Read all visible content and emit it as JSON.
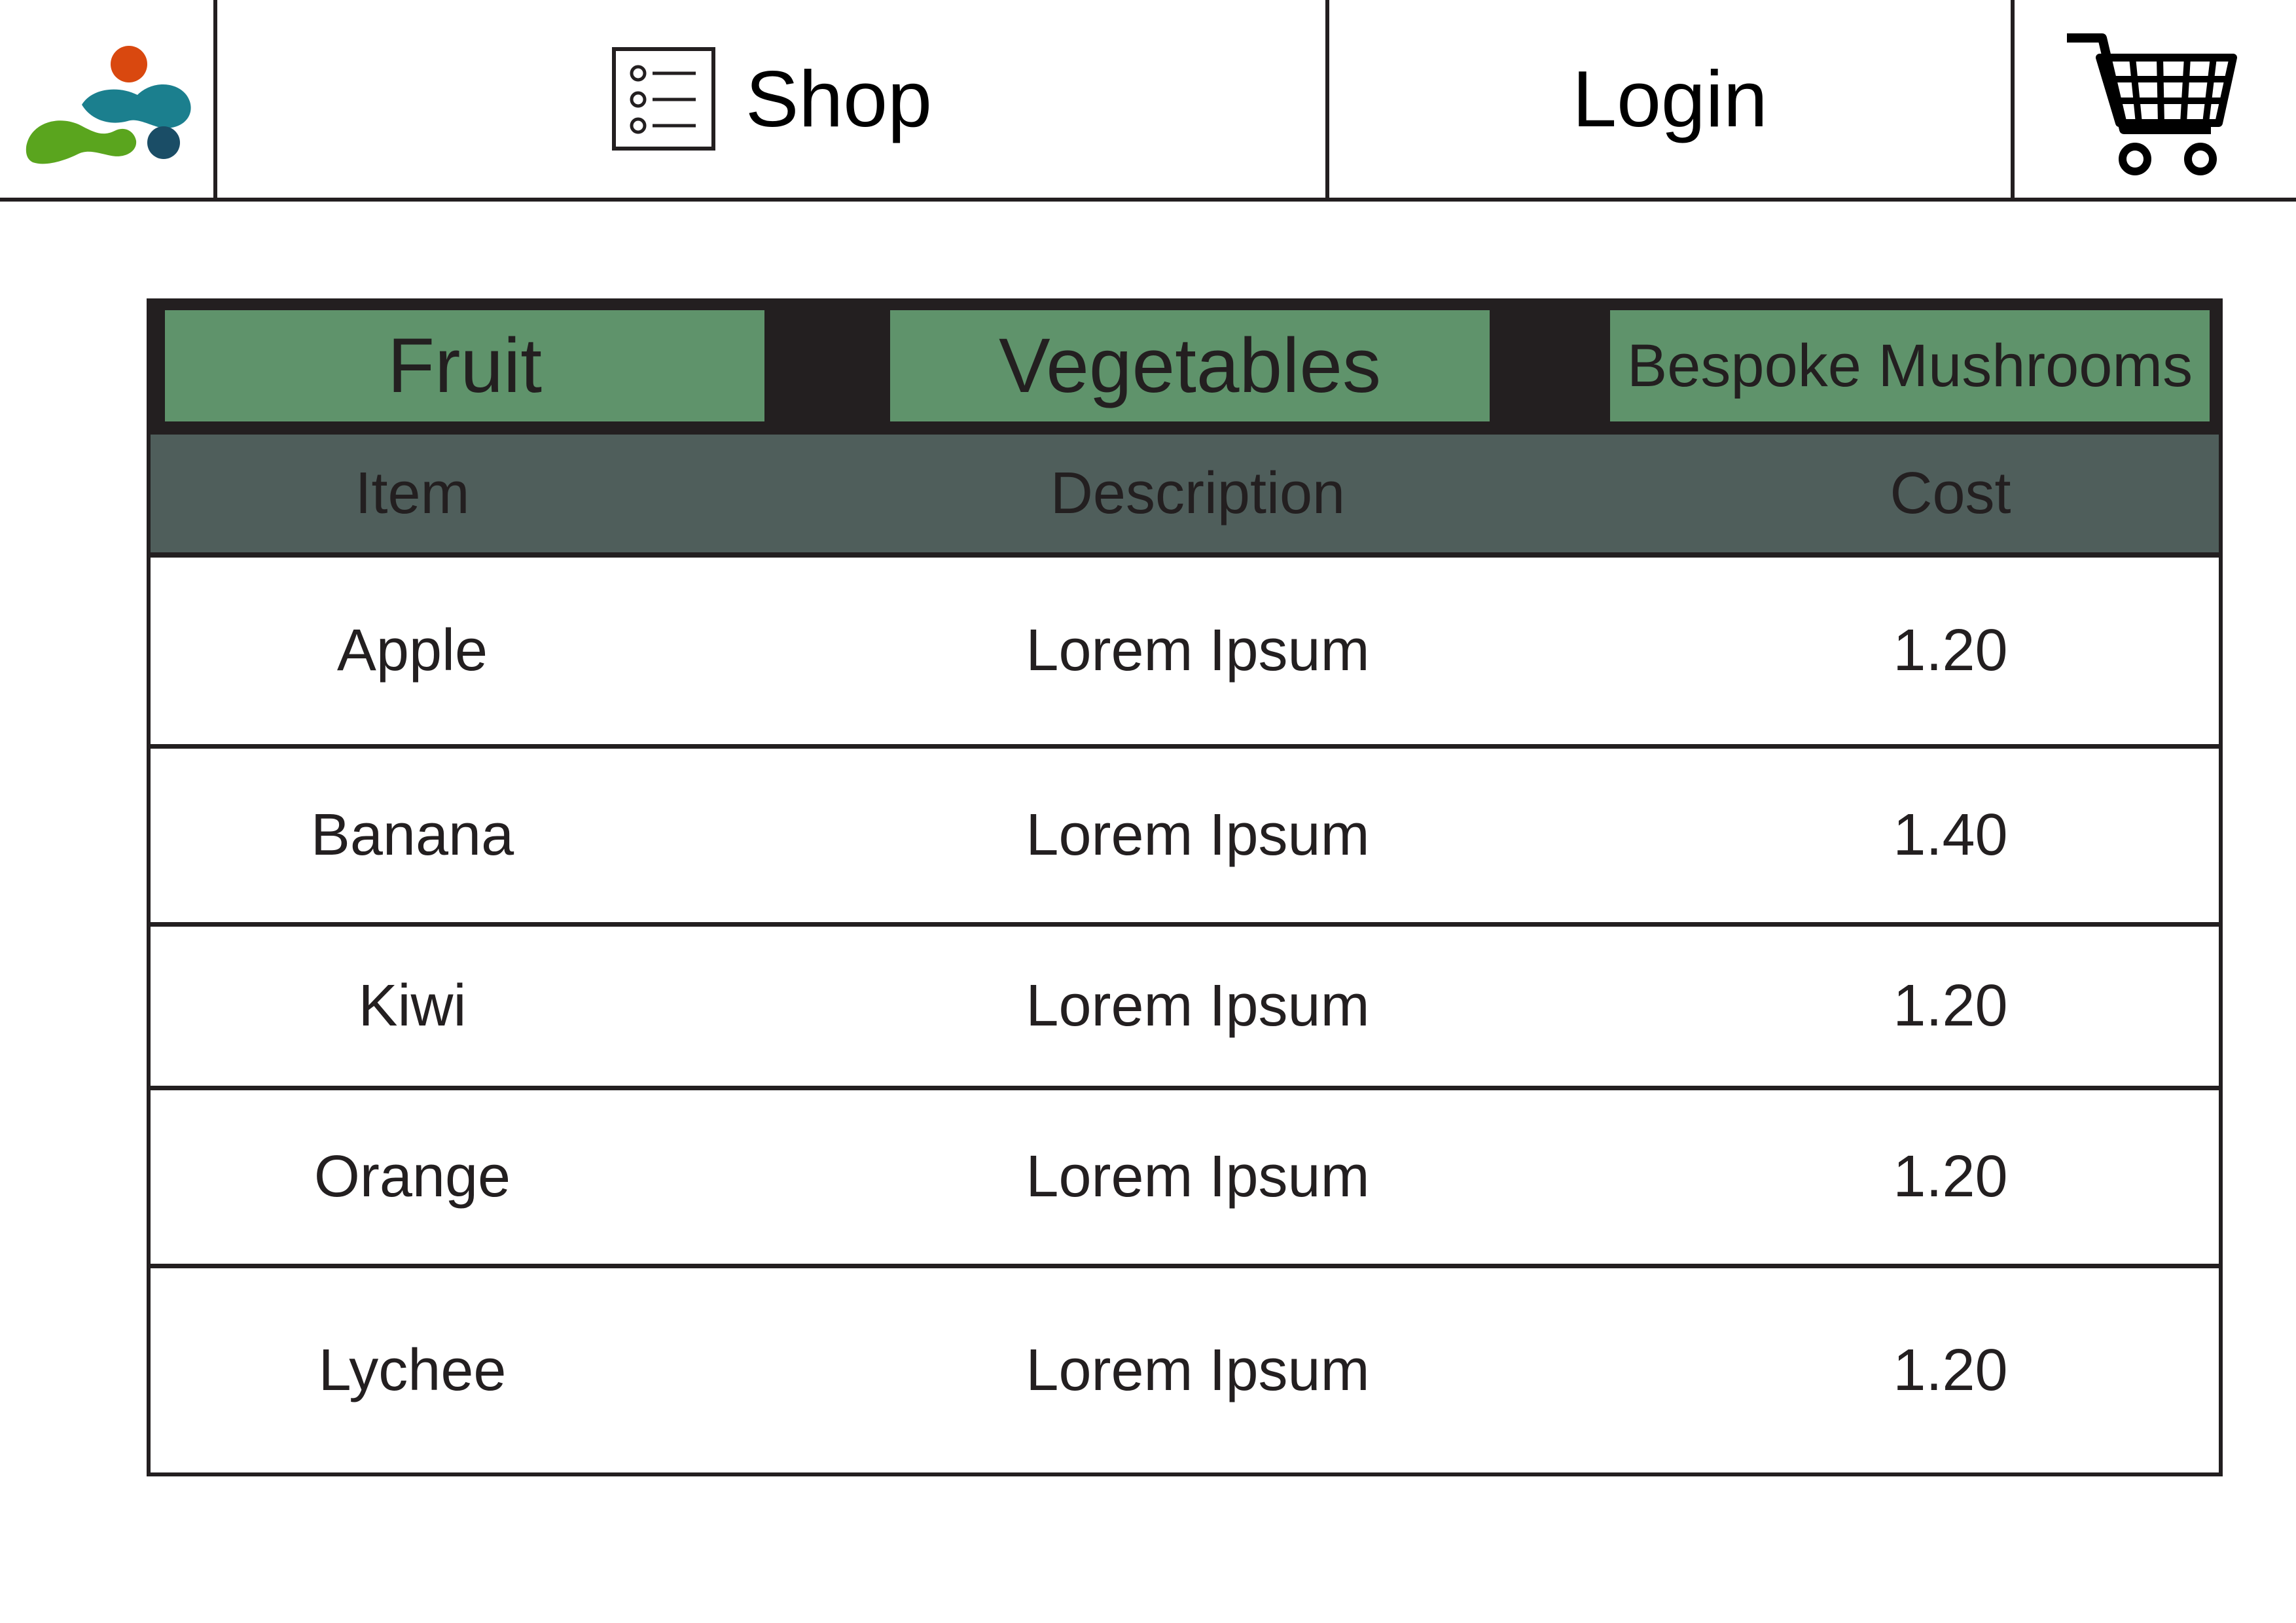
{
  "header": {
    "nav_shop_label": "Shop",
    "nav_login_label": "Login",
    "logo_colors": [
      "#d9480f",
      "#1b7f8e",
      "#5aa51e",
      "#1a4d66"
    ]
  },
  "categories": {
    "tabs": [
      {
        "label": "Fruit"
      },
      {
        "label": "Vegetables"
      },
      {
        "label": "Bespoke Mushrooms"
      }
    ],
    "tab_color": "#5f936b"
  },
  "table": {
    "columns": [
      "Item",
      "Description",
      "Cost"
    ],
    "header_color": "#4f5e5b",
    "rows": [
      {
        "item": "Apple",
        "description": "Lorem Ipsum",
        "cost": "1.20"
      },
      {
        "item": "Banana",
        "description": "Lorem Ipsum",
        "cost": "1.40"
      },
      {
        "item": "Kiwi",
        "description": "Lorem Ipsum",
        "cost": "1.20"
      },
      {
        "item": "Orange",
        "description": "Lorem Ipsum",
        "cost": "1.20"
      },
      {
        "item": "Lychee",
        "description": "Lorem Ipsum",
        "cost": "1.20"
      }
    ]
  },
  "icons": [
    "app-logo",
    "list-icon",
    "cart-icon"
  ]
}
